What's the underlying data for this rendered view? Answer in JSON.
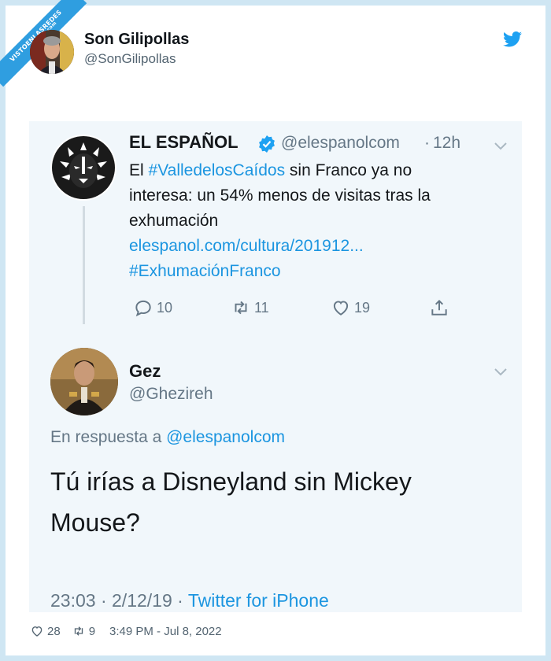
{
  "watermark": {
    "text": "VISTOENLASREDES",
    "suffix": ".com"
  },
  "header": {
    "name": "Son Gilipollas",
    "handle": "@SonGilipollas",
    "icon": "twitter-bird-icon",
    "accent": "#1da1f2"
  },
  "quoted": {
    "tweet1": {
      "name": "EL ESPAÑOL",
      "verified_icon": "verified-badge-icon",
      "handle": "@elespanolcom",
      "dot": "·",
      "time": "12h",
      "lines": [
        {
          "pre": "El ",
          "tag": "#ValledelosCaídos",
          "post": " sin Franco ya no"
        },
        {
          "text": "interesa: un 54% menos de visitas tras la"
        },
        {
          "text": "exhumación"
        }
      ],
      "link": "elespanol.com/cultura/201912...",
      "hashtag": "#ExhumaciónFranco",
      "actions": {
        "replies": "10",
        "retweets": "11",
        "likes": "19"
      }
    },
    "tweet2": {
      "name": "Gez",
      "handle": "@Ghezireh",
      "reply_prefix": "En respuesta a",
      "reply_handle": "@elespanolcom",
      "text_lines": [
        "Tú irías a Disneyland sin Mickey",
        "Mouse?"
      ],
      "time": "23:03",
      "date": "2/12/19",
      "sep": "·",
      "client": "Twitter for iPhone"
    }
  },
  "footer": {
    "likes": "28",
    "retweets": "9",
    "timestamp": "3:49 PM - Jul 8, 2022"
  }
}
